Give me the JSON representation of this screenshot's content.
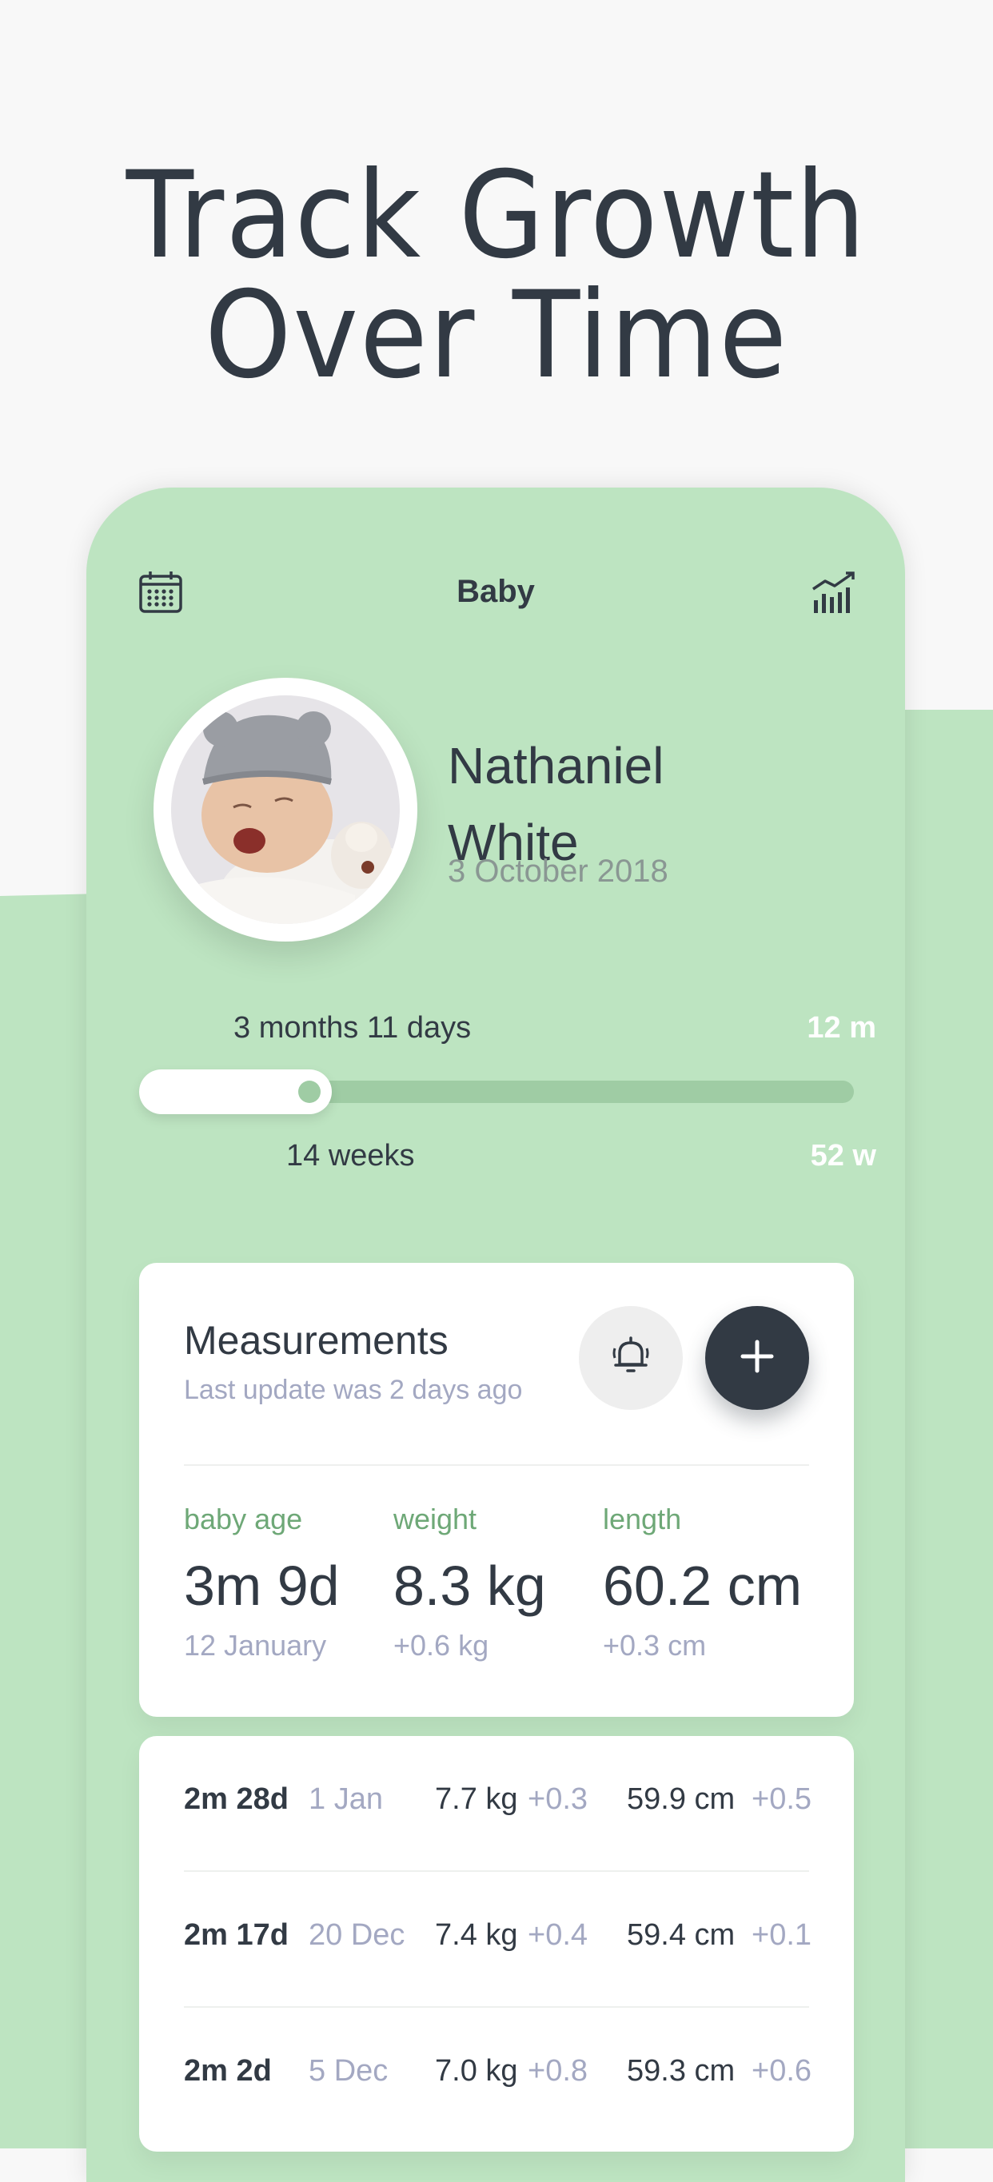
{
  "headline": {
    "line1": "Track Growth",
    "line2": "Over Time"
  },
  "topbar": {
    "title": "Baby",
    "calendar_icon": "calendar-icon",
    "stats_icon": "growth-chart-icon"
  },
  "profile": {
    "first_name": "Nathaniel",
    "last_name": "White",
    "birth_date": "3 October 2018"
  },
  "age": {
    "months_label": "3 months 11 days",
    "months_max": "12 m",
    "weeks_label": "14 weeks",
    "weeks_max": "52 w",
    "progress_weeks": 14,
    "progress_total": 52
  },
  "measurements": {
    "title": "Measurements",
    "subtitle": "Last update was 2 days ago",
    "stats": [
      {
        "label": "baby age",
        "value": "3m 9d",
        "sub": "12 January"
      },
      {
        "label": "weight",
        "value": "8.3 kg",
        "sub": "+0.6 kg"
      },
      {
        "label": "length",
        "value": "60.2 cm",
        "sub": "+0.3 cm"
      }
    ]
  },
  "history": [
    {
      "age": "2m 28d",
      "date": "1 Jan",
      "weight": "7.7 kg",
      "weight_delta": "+0.3",
      "length": "59.9 cm",
      "length_delta": "+0.5"
    },
    {
      "age": "2m 17d",
      "date": "20 Dec",
      "weight": "7.4 kg",
      "weight_delta": "+0.4",
      "length": "59.4 cm",
      "length_delta": "+0.1"
    },
    {
      "age": "2m 2d",
      "date": "5 Dec",
      "weight": "7.0 kg",
      "weight_delta": "+0.8",
      "length": "59.3 cm",
      "length_delta": "+0.6"
    }
  ],
  "colors": {
    "accent_green": "#bde4c1",
    "dark": "#323a44",
    "muted": "#a3a8c2",
    "label_green": "#6ea877"
  }
}
